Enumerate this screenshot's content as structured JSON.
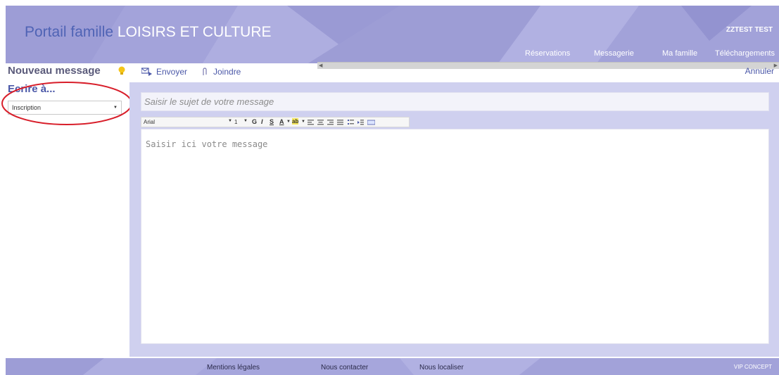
{
  "header": {
    "brand_part1": "Portail famille",
    "brand_part2": "LOISIRS ET CULTURE",
    "user_name": "ZZTEST TEST",
    "nav": [
      "Réservations",
      "Messagerie",
      "Ma famille",
      "Téléchargements"
    ]
  },
  "toolbar": {
    "title": "Nouveau message",
    "send_label": "Envoyer",
    "attach_label": "Joindre",
    "cancel_label": "Annuler"
  },
  "recipient": {
    "heading": "Ecrire à...",
    "selected": "Inscription"
  },
  "compose": {
    "subject_placeholder": "Saisir le sujet de votre message",
    "body_placeholder": "Saisir ici votre message",
    "font_value": "Arial",
    "size_value": "1"
  },
  "footer": {
    "links": [
      "Mentions légales",
      "Nous contacter",
      "Nous localiser"
    ],
    "credit": "VIP CONCEPT"
  },
  "colors": {
    "header_bg": "#a6a6dc",
    "accent": "#4b58a8",
    "pane_bg": "#cfd0ef",
    "annotation": "#d81e2a"
  }
}
